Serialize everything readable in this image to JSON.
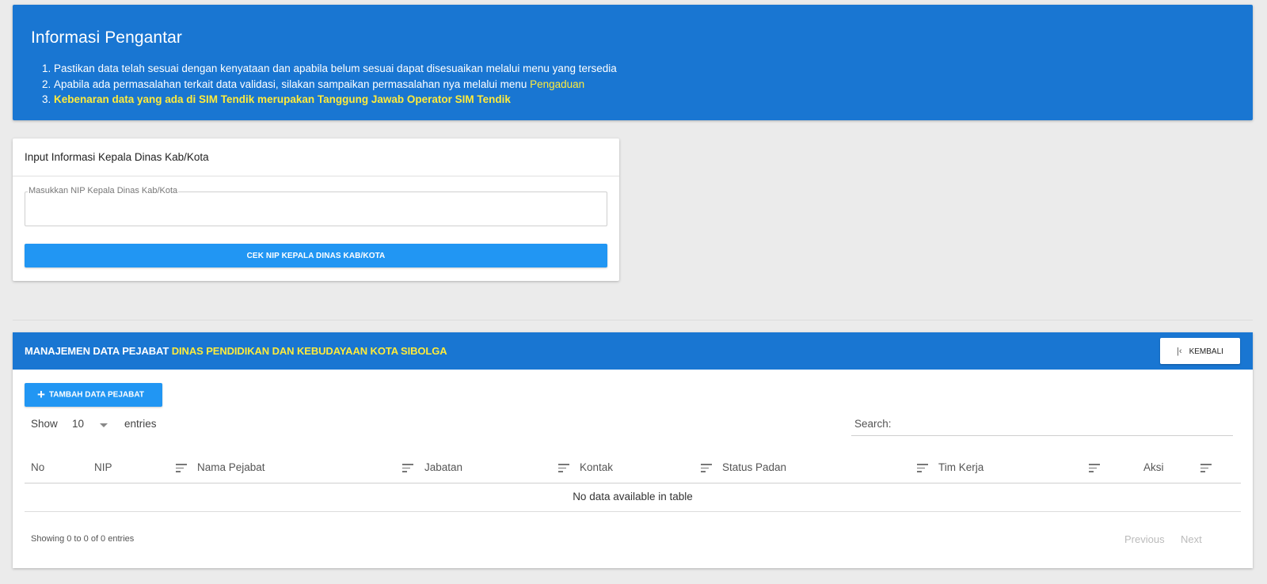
{
  "info": {
    "title": "Informasi Pengantar",
    "items": [
      {
        "num": "1.",
        "text": "Pastikan data telah sesuai dengan kenyataan dan apabila belum sesuai dapat disesuaikan melalui menu yang tersedia"
      },
      {
        "num": "2.",
        "text": "Apabila ada permasalahan terkait data validasi, silakan sampaikan permasalahan nya melalui menu ",
        "link": "Pengaduan"
      },
      {
        "num": "3.",
        "text": "Kebenaran data yang ada di SIM Tendik merupakan Tanggung Jawab Operator SIM Tendik"
      }
    ]
  },
  "kepala_form": {
    "title": "Input Informasi Kepala Dinas Kab/Kota",
    "nip_label": "Masukkan NIP Kepala Dinas Kab/Kota",
    "nip_value": "",
    "button_label": "CEK NIP KEPALA DINAS KAB/KOTA"
  },
  "pejabat": {
    "title_prefix": "MANAJEMEN DATA PEJABAT",
    "title_highlight": "DINAS PENDIDIKAN DAN KEBUDAYAAN KOTA SIBOLGA",
    "kembali_label": "KEMBALI",
    "tambah_label": "TAMBAH DATA PEJABAT",
    "show_label": "Show",
    "page_length": "10",
    "entries_label": "entries",
    "search_label": "Search:",
    "search_value": "",
    "columns": [
      "No",
      "NIP",
      "Nama Pejabat",
      "Jabatan",
      "Kontak",
      "Status Padan",
      "Tim Kerja",
      "Aksi"
    ],
    "empty_message": "No data available in table",
    "showing_text": "Showing 0 to 0 of 0 entries",
    "previous_label": "Previous",
    "next_label": "Next"
  },
  "colors": {
    "primary_blue": "#1976d2",
    "button_blue": "#2196f3",
    "highlight_yellow": "#ffeb3b",
    "background": "#ebebeb"
  },
  "icons": {
    "kembali": "first-page-icon",
    "tambah": "plus-icon",
    "sort": "sort-icon",
    "dropdown": "caret-down-icon"
  }
}
